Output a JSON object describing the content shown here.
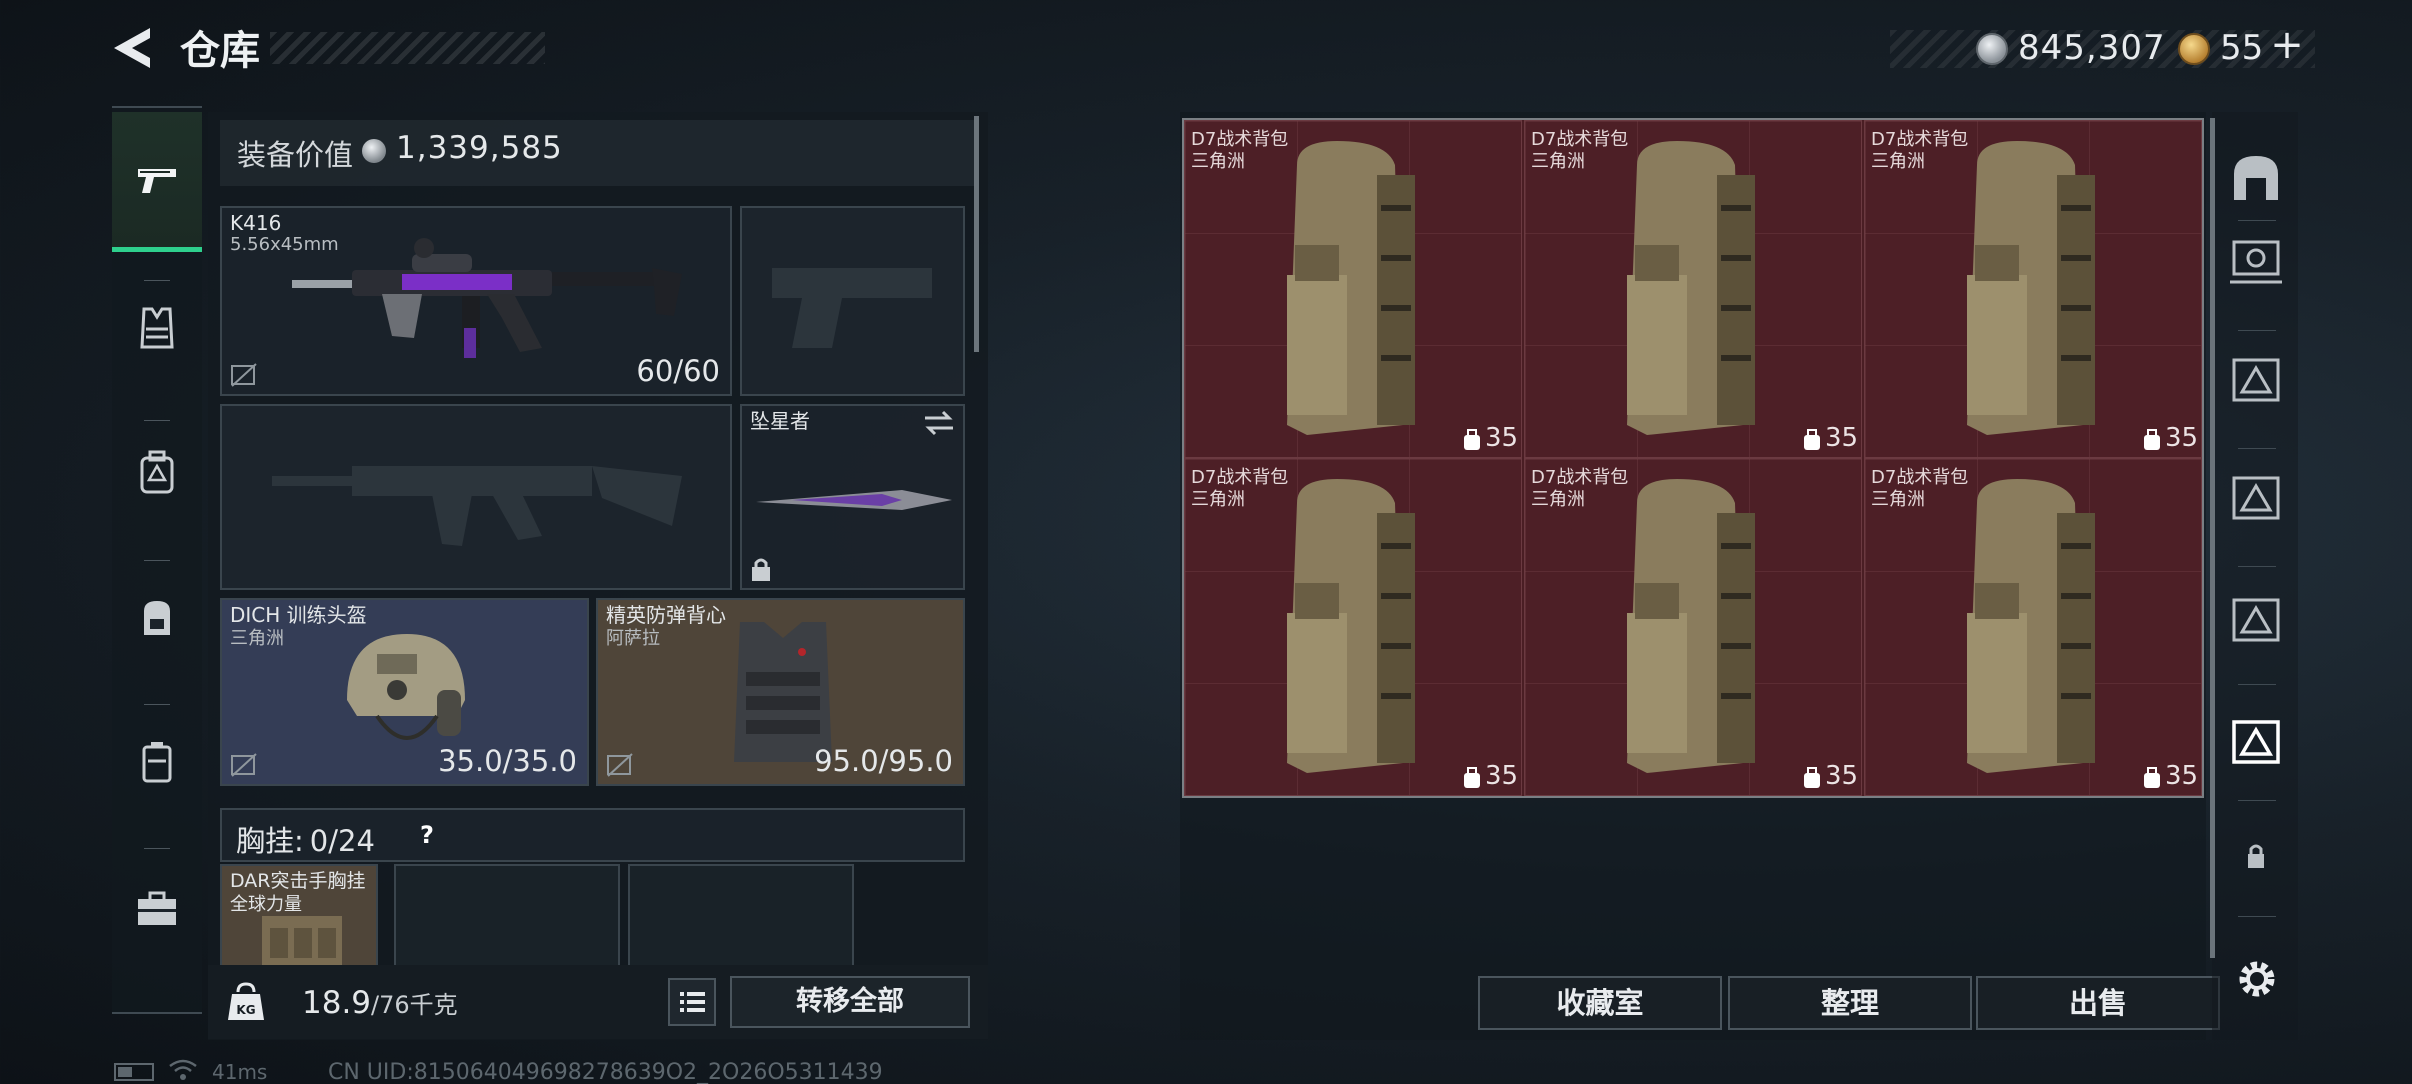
{
  "header": {
    "title": "仓库",
    "coin1_value": "845,307",
    "coin2_value": "55",
    "plus_label": "+"
  },
  "equipment": {
    "value_label": "装备价值",
    "value": "1,339,585",
    "primary": {
      "name": "K416",
      "caliber": "5.56x45mm",
      "durability": "60/60"
    },
    "melee": {
      "name": "坠星者"
    },
    "helmet": {
      "name": "DICH 训练头盔",
      "faction": "三角洲",
      "durability": "35.0/35.0"
    },
    "armor": {
      "name": "精英防弹背心",
      "faction": "阿萨拉",
      "durability": "95.0/95.0"
    },
    "chest_rig": {
      "label": "胸挂",
      "count": "0/24",
      "help": "?"
    },
    "vest": {
      "name": "DAR突击手胸挂",
      "faction": "全球力量"
    },
    "weight": {
      "current": "18.9",
      "max": "/76千克"
    },
    "transfer_all": "转移全部"
  },
  "storage": {
    "bags": [
      {
        "name": "D7战术背包",
        "faction": "三角洲",
        "capacity": "35"
      },
      {
        "name": "D7战术背包",
        "faction": "三角洲",
        "capacity": "35"
      },
      {
        "name": "D7战术背包",
        "faction": "三角洲",
        "capacity": "35"
      },
      {
        "name": "D7战术背包",
        "faction": "三角洲",
        "capacity": "35"
      },
      {
        "name": "D7战术背包",
        "faction": "三角洲",
        "capacity": "35"
      },
      {
        "name": "D7战术背包",
        "faction": "三角洲",
        "capacity": "35"
      }
    ],
    "buttons": {
      "collection": "收藏室",
      "sort": "整理",
      "sell": "出售"
    }
  },
  "status": {
    "ping": "41ms",
    "uid": "CN UID:815064049698278639O2_2O26O5311439"
  },
  "colors": {
    "accent_green": "#2ed08d",
    "storage_bg": "#4a1e24",
    "helmet_bg": "#343d56",
    "armor_bg": "#4f4539"
  },
  "icons": {
    "back": "back-arrow-icon",
    "left_nav": [
      "pistol-icon",
      "vest-icon",
      "backpack-plus-icon",
      "backpack-icon",
      "case-icon",
      "toolbox-icon"
    ],
    "right_nav": [
      "arch-icon",
      "storage-box-icon",
      "warning-crate-icon-1",
      "warning-crate-icon-2",
      "warning-crate-icon-3",
      "warning-crate-icon-4",
      "lock-icon",
      "settings-icon"
    ]
  }
}
